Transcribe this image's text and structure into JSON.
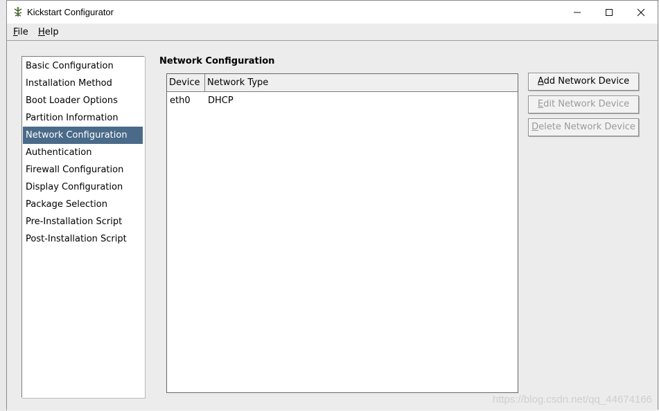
{
  "window": {
    "title": "Kickstart Configurator",
    "controls": {
      "minimize_icon": "minimize-icon",
      "maximize_icon": "maximize-icon",
      "close_icon": "close-icon"
    }
  },
  "menubar": {
    "file": {
      "mnemonic": "F",
      "rest": "ile"
    },
    "help": {
      "mnemonic": "H",
      "rest": "elp"
    }
  },
  "sidebar": {
    "selected_index": 4,
    "items": [
      "Basic Configuration",
      "Installation Method",
      "Boot Loader Options",
      "Partition Information",
      "Network Configuration",
      "Authentication",
      "Firewall Configuration",
      "Display Configuration",
      "Package Selection",
      "Pre-Installation Script",
      "Post-Installation Script"
    ]
  },
  "main": {
    "title": "Network Configuration",
    "table": {
      "columns": [
        "Device",
        "Network Type"
      ],
      "rows": [
        {
          "device": "eth0",
          "type": "DHCP"
        }
      ]
    },
    "buttons": {
      "add": {
        "mnemonic": "A",
        "rest": "dd Network Device",
        "enabled": true
      },
      "edit": {
        "mnemonic": "E",
        "rest": "dit Network Device",
        "enabled": false
      },
      "delete": {
        "mnemonic": "D",
        "rest": "elete Network Device",
        "enabled": false
      }
    }
  },
  "colors": {
    "selection": "#4a6a8a",
    "disabled_text": "#9a9a9a"
  },
  "watermark": "https://blog.csdn.net/qq_44674166"
}
